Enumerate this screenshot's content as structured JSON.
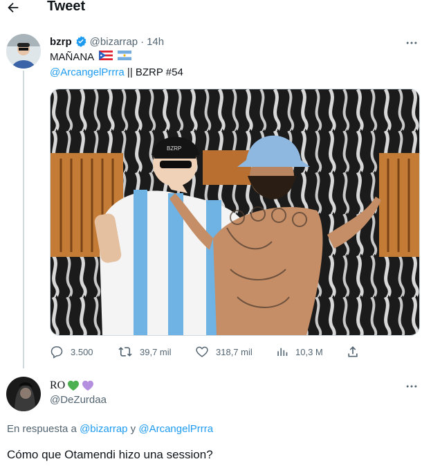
{
  "header": {
    "title": "Tweet"
  },
  "tweet": {
    "author_name": "bzrp",
    "handle": "@bizarrap",
    "separator": "·",
    "time": "14h",
    "text_line1": "MAÑANA",
    "mention": "@ArcangelPrrra",
    "text_line2_rest": " || BZRP #54",
    "stats": {
      "replies": "3.500",
      "retweets": "39,7 mil",
      "likes": "318,7 mil",
      "views": "10,3 M"
    }
  },
  "reply": {
    "author_name": "RO",
    "handle": "@DeZurdaa",
    "replying_prefix": "En respuesta a",
    "replying_user1": "@bizarrap",
    "replying_joiner": "y",
    "replying_user2": "@ArcangelPrrra",
    "text": "Cómo que Otamendi hizo una session?"
  },
  "colors": {
    "accent": "#1d9bf0",
    "muted": "#536471",
    "verified": "#1d9bf0",
    "heart_green": "#4caf50",
    "heart_purple": "#b48fe0"
  },
  "icons": [
    "back-arrow-icon",
    "verified-badge-icon",
    "more-icon",
    "reply-icon",
    "retweet-icon",
    "like-icon",
    "views-icon",
    "share-icon",
    "heart-icon"
  ]
}
